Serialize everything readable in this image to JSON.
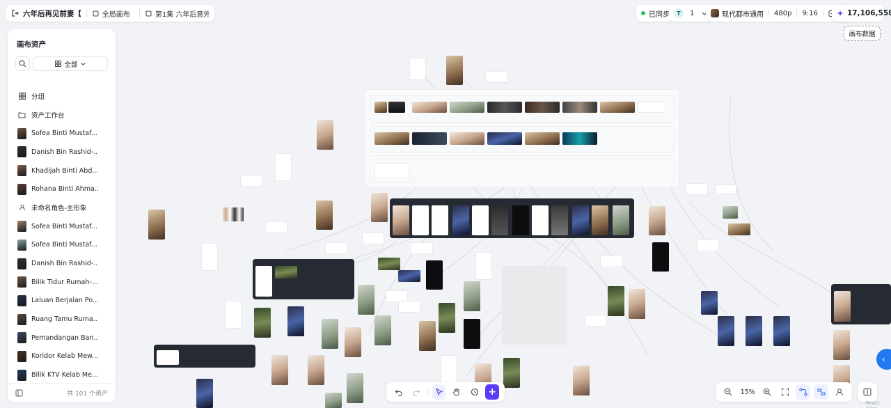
{
  "topbar": {
    "project_title": "六年后再见前妻【...",
    "canvas_scope": "全局画布",
    "episode": "第1集 六年后意外...",
    "sync_status": "已同步",
    "t_badge": "T",
    "t_count": "1",
    "style_preset": "现代都市通用",
    "resolution": "480p",
    "aspect_ratio": "9:16",
    "credits": "17,106,558"
  },
  "canvas_data_button": "画布数据",
  "sidebar": {
    "title": "画布资产",
    "filter_label": "全部",
    "items": [
      {
        "label": "分组",
        "kind": "grid-icon"
      },
      {
        "label": "资产工作台",
        "kind": "folder-icon"
      },
      {
        "label": "Sofea Binti Mustaf...",
        "kind": "thumb",
        "color": "#6b5446"
      },
      {
        "label": "Danish Bin Rashid-...",
        "kind": "thumb",
        "color": "#2c2e33"
      },
      {
        "label": "Khadijah Binti Abd...",
        "kind": "thumb",
        "color": "#7b5f4c"
      },
      {
        "label": "Rohana Binti Ahma...",
        "kind": "thumb",
        "color": "#5a3e33"
      },
      {
        "label": "未命名角色-主形象",
        "kind": "user-icon"
      },
      {
        "label": "Sofea Binti Mustaf...",
        "kind": "thumb",
        "color": "#9b7f6a"
      },
      {
        "label": "Sofea Binti Mustaf...",
        "kind": "thumb",
        "color": "#8aa3a7"
      },
      {
        "label": "Danish Bin Rashid-...",
        "kind": "thumb",
        "color": "#2e3036"
      },
      {
        "label": "Bilik Tidur Rumah-...",
        "kind": "thumb",
        "color": "#6e5948"
      },
      {
        "label": "Laluan Berjalan Po...",
        "kind": "thumb",
        "color": "#243045"
      },
      {
        "label": "Ruang Tamu Ruma...",
        "kind": "thumb",
        "color": "#5a4a3a"
      },
      {
        "label": "Pemandangan Ban...",
        "kind": "thumb",
        "color": "#3a4a66"
      },
      {
        "label": "Koridor Kelab Mew...",
        "kind": "thumb",
        "color": "#4a3424"
      },
      {
        "label": "Bilik KTV Kelab Me...",
        "kind": "thumb",
        "color": "#1f3a5c"
      }
    ],
    "footer_count": "共 101 个资产"
  },
  "toolbar": {
    "zoom": "15%"
  },
  "watermark": "React Flow"
}
